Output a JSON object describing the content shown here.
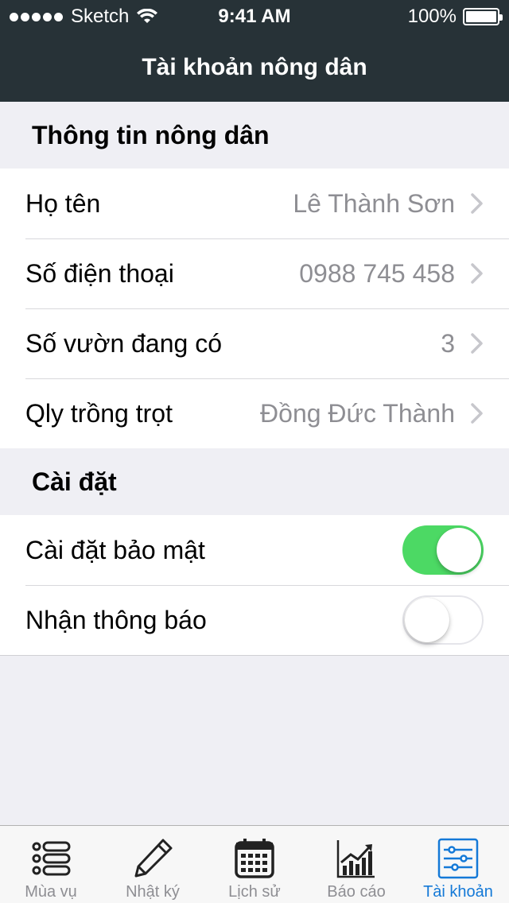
{
  "status_bar": {
    "carrier": "Sketch",
    "time": "9:41 AM",
    "battery": "100%"
  },
  "nav": {
    "title": "Tài khoản nông dân"
  },
  "farmer_section": {
    "title": "Thông tin nông dân",
    "rows": [
      {
        "label": "Họ tên",
        "value": "Lê Thành Sơn"
      },
      {
        "label": "Số điện thoại",
        "value": "0988 745 458"
      },
      {
        "label": "Số vườn đang có",
        "value": "3"
      },
      {
        "label": "Qly trồng trọt",
        "value": "Đồng Đức Thành"
      }
    ]
  },
  "settings_section": {
    "title": "Cài đặt",
    "rows": [
      {
        "label": "Cài đặt bảo mật",
        "on": true
      },
      {
        "label": "Nhận thông báo",
        "on": false
      }
    ]
  },
  "tabs": [
    {
      "label": "Mùa vụ",
      "icon": "list-icon",
      "active": false
    },
    {
      "label": "Nhật ký",
      "icon": "pencil-icon",
      "active": false
    },
    {
      "label": "Lịch sử",
      "icon": "calendar-icon",
      "active": false
    },
    {
      "label": "Báo cáo",
      "icon": "chart-icon",
      "active": false
    },
    {
      "label": "Tài khoản",
      "icon": "settings-sliders-icon",
      "active": true
    }
  ],
  "colors": {
    "nav_bg": "#273237",
    "switch_on": "#4cd964",
    "tab_active": "#1479d7",
    "tab_inactive": "#8e8e93"
  }
}
